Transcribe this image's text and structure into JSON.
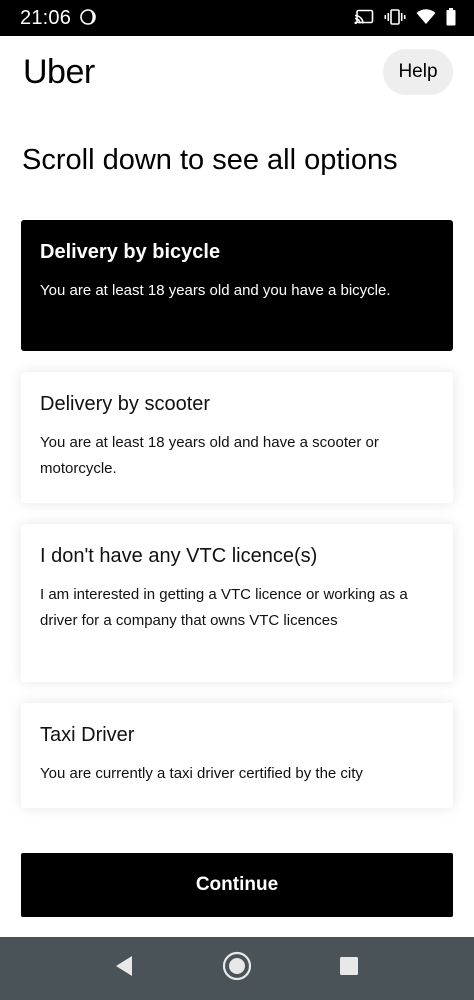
{
  "status_bar": {
    "time": "21:06",
    "icons": [
      "moon-icon",
      "cast-icon",
      "vibrate-icon",
      "wifi-icon",
      "battery-icon"
    ]
  },
  "header": {
    "brand": "Uber",
    "help_label": "Help"
  },
  "page": {
    "title": "Scroll down to see all options"
  },
  "options": [
    {
      "title": "Delivery by bicycle",
      "description": "You are at least 18 years old and you have a bicycle.",
      "selected": true
    },
    {
      "title": "Delivery by scooter",
      "description": "You are at least 18 years old and have a scooter or motorcycle.",
      "selected": false
    },
    {
      "title": "I don't have any VTC licence(s)",
      "description": "I am interested in getting a VTC licence or working as a driver for a company that owns VTC licences",
      "selected": false
    },
    {
      "title": "Taxi Driver",
      "description": "You are currently a taxi driver certified by the city",
      "selected": false
    }
  ],
  "footer": {
    "continue_label": "Continue"
  },
  "nav_bar": {
    "icons": [
      "back-icon",
      "home-icon",
      "recents-icon"
    ]
  },
  "colors": {
    "selected_card": "#000000",
    "nav_bar": "#4a5358",
    "help_button": "#eeeeee"
  }
}
